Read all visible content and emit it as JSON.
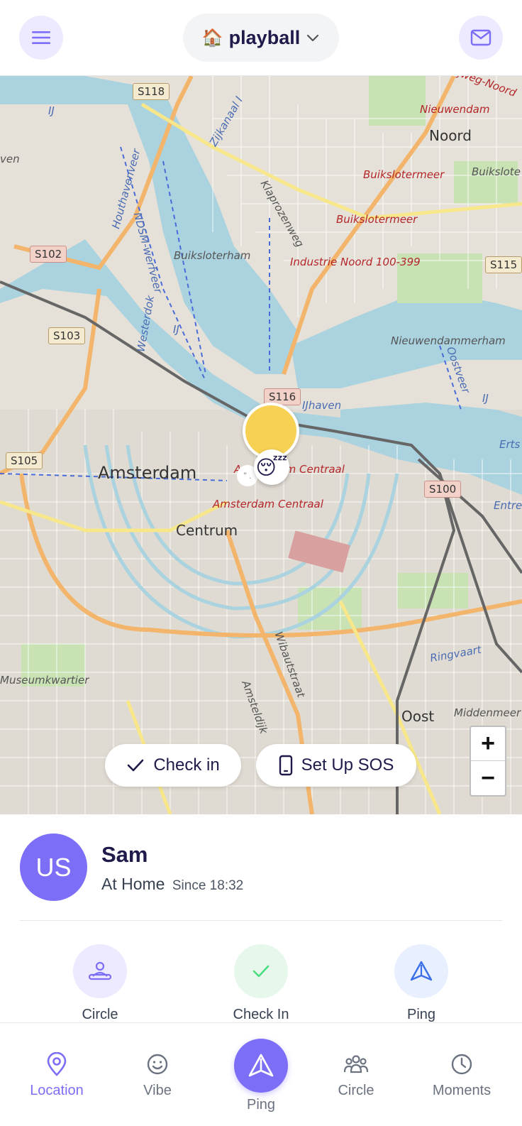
{
  "header": {
    "circle_emoji": "🏠",
    "circle_name": "playball"
  },
  "map": {
    "labels": {
      "amsterdam": "Amsterdam",
      "centrum": "Centrum",
      "noord": "Noord",
      "oost": "Oost",
      "nieuwendam": "Nieuwendam",
      "buiksloterham": "Buiksloterham",
      "buikslotermeer_1": "Buikslotermeer",
      "buikslotermeer_2": "Buikslotermeer",
      "buiksloten": "Buikslote",
      "industrie": "Industrie Noord 100-399",
      "nieuwendammerham": "Nieuwendammerham",
      "amsterdam_centraal_1": "Amsterdam Centraal",
      "amsterdam_centraal_2": "Amsterdam Centraal",
      "museumkwartier": "Museumkwartier",
      "ijhaven": "IJhaven",
      "houthavenweer": "Houthavenveer",
      "ndsm": "NDSM-werfveer",
      "westerdok": "Westerdok",
      "ij_1": "IJ",
      "ij_2": "IJ",
      "ij_3": "IJ",
      "oostveer": "Oostveer",
      "klaprozenweg": "Klaprozenweg",
      "zijkanaal": "Zijkanaal I",
      "wibautstraat": "Wibautstraat",
      "amsteldijk": "Amsteldijk",
      "ringvaart": "Ringvaart",
      "middenmeer": "Middenmeer",
      "ven": "ven",
      "erts": "Erts",
      "entre": "Entre",
      "weg_noord": "ijweg-Noord"
    },
    "shields": {
      "s118": "S118",
      "s102": "S102",
      "s103": "S103",
      "s105": "S105",
      "s100": "S100",
      "s115": "S115",
      "s116": "S116"
    },
    "marker_emoji": "😴",
    "marker_dots": "\" ."
  },
  "actions": {
    "checkin_label": "Check in",
    "sos_label": "Set Up SOS"
  },
  "zoom": {
    "in": "+",
    "out": "−"
  },
  "user": {
    "initials": "US",
    "name": "Sam",
    "status": "At Home",
    "since": "Since 18:32"
  },
  "quick_actions": {
    "circle": "Circle",
    "checkin": "Check In",
    "ping": "Ping"
  },
  "nav": {
    "location": "Location",
    "vibe": "Vibe",
    "ping": "Ping",
    "circle": "Circle",
    "moments": "Moments"
  },
  "colors": {
    "accent": "#7c6ef6",
    "marker": "#f7d154",
    "water": "#aad3df"
  }
}
